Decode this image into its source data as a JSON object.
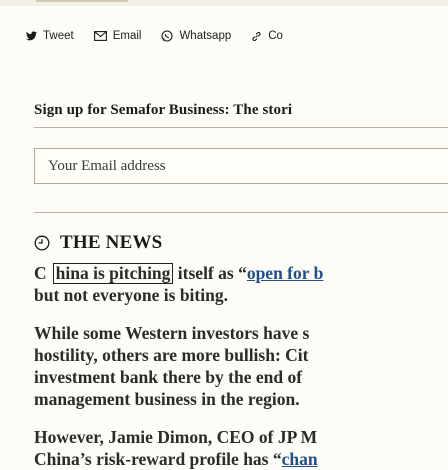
{
  "share": {
    "tweet": "Tweet",
    "email": "Email",
    "whatsapp": "Whatsapp",
    "copy": "Co"
  },
  "signup": {
    "text": "Sign up for Semafor Business: The stori",
    "email_placeholder": "Your Email address"
  },
  "section": {
    "title": "THE NEWS"
  },
  "article": {
    "p1_start": "C",
    "p1_highlight": "hina is pitching",
    "p1_mid": " itself as “",
    "p1_link": "open for b",
    "p1_l2": "but not everyone is biting.",
    "p2_l1": "While some Western investors have s",
    "p2_l2": "hostility, others are more bullish: Cit",
    "p2_l3": "investment bank there by the end of",
    "p2_l4": "management business in the region.",
    "p3_l1": "However, Jamie Dimon, CEO of JP M",
    "p3_l2_start": "China’s risk-reward profile has “",
    "p3_l2_link": "chan"
  },
  "colors": {
    "background": "#fefcf6",
    "link": "#1f4e8a"
  },
  "icons": [
    "twitter-bird-icon",
    "envelope-icon",
    "whatsapp-icon",
    "link-icon",
    "clock-icon"
  ]
}
